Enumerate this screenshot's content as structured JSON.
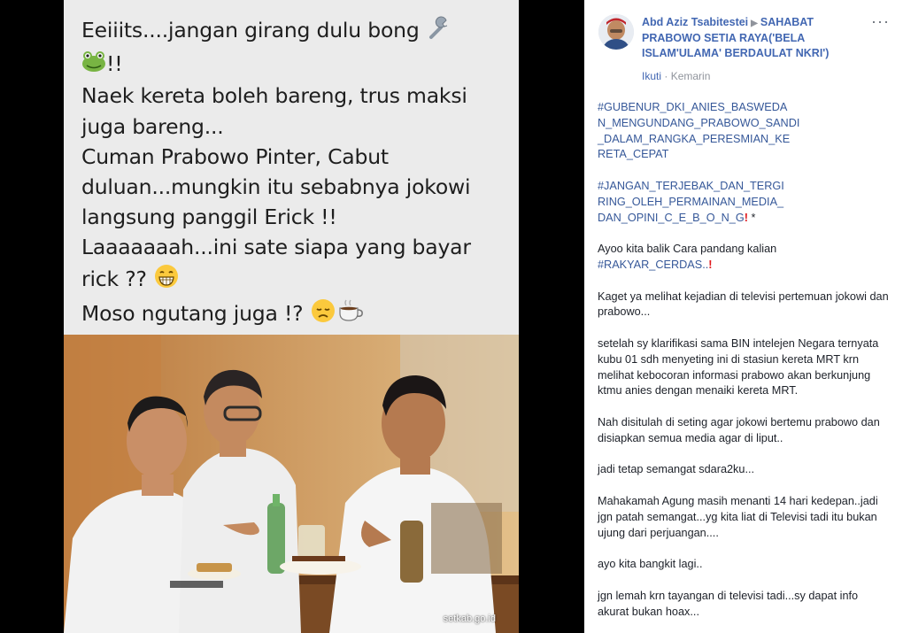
{
  "meme": {
    "lines": [
      "Eeiiits....jangan girang dulu bong",
      "!!",
      "Naek kereta boleh bareng, trus maksi",
      "juga bareng...",
      "Cuman Prabowo Pinter, Cabut",
      "duluan...mungkin itu sebabnya jokowi",
      "langsung panggil Erick !!",
      "Laaaaaaah...ini sate siapa yang bayar",
      "rick ??",
      "Moso ngutang juga  !?"
    ],
    "photo_credit": "setkab.go.id"
  },
  "post": {
    "author": "Abd Aziz Tsabitestei",
    "group": "SAHABAT PRABOWO SETIA RAYA('BELA ISLAM'ULAMA' BERDAULAT NKRI')",
    "follow_label": "Ikuti",
    "separator": "·",
    "time": "Kemarin",
    "more_label": "···",
    "hashtag1_lines": [
      "#GUBENUR_DKI_ANIES_BASWEDA",
      "N_MENGUNDANG_PRABOWO_SANDI",
      "_DALAM_RANGKA_PERESMIAN_KE",
      "RETA_CEPAT"
    ],
    "hashtag2_lines": [
      "#JANGAN_TERJEBAK_DAN_TERGI",
      "RING_OLEH_PERMAINAN_MEDIA_",
      "DAN_OPINI_C_E_B_O_N_G"
    ],
    "hashtag2_suffix": " *",
    "para1_text": "Ayoo kita balik Cara pandang kalian",
    "para1_tag": "#RAKYAR_CERDAS..",
    "para2": "Kaget ya melihat kejadian di televisi pertemuan jokowi dan prabowo...",
    "para3": "setelah sy klarifikasi sama BIN intelejen Negara ternyata kubu 01 sdh menyeting ini di stasiun kereta MRT krn melihat kebocoran informasi prabowo akan berkunjung ktmu anies dengan menaiki kereta MRT.",
    "para4": "Nah disitulah di seting agar jokowi bertemu prabowo dan disiapkan semua media agar di liput..",
    "para5": "jadi tetap semangat sdara2ku...",
    "para6": "Mahakamah Agung masih menanti 14 hari kedepan..jadi jgn patah semangat...yg kita liat di Televisi tadi itu bukan ujung dari perjuangan....",
    "para7": "ayo kita bangkit lagi..",
    "para8": "jgn lemah krn tayangan di televisi tadi...sy dapat info akurat bukan hoax..."
  },
  "colors": {
    "link": "#365899",
    "name": "#4267b2",
    "meta": "#90949c",
    "exclamation": "#e0191e"
  },
  "icons": [
    "wrench-icon",
    "frog-icon",
    "grin-icon",
    "sad-face-icon",
    "coffee-icon",
    "red-exclamation-icon",
    "more-options-icon"
  ]
}
